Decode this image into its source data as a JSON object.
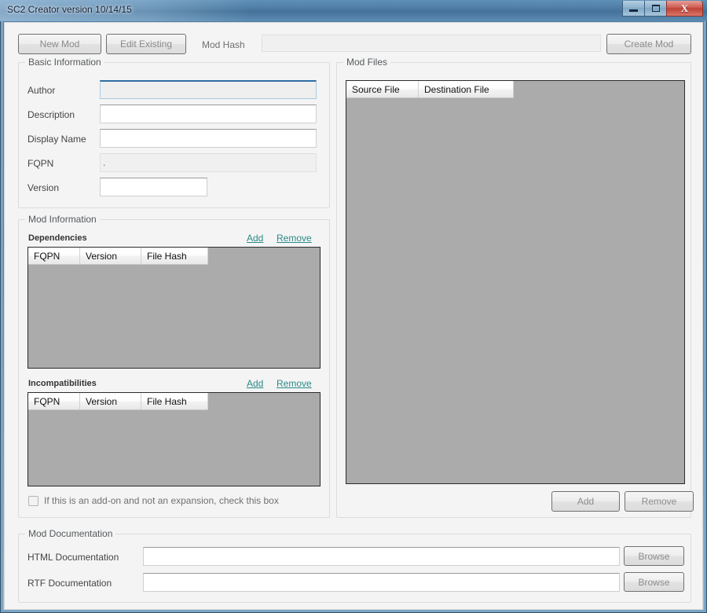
{
  "window": {
    "title": "SC2 Creator version 10/14/15",
    "controls": {
      "minimize": "minimize-button",
      "maximize": "maximize-button",
      "close": "X"
    }
  },
  "toolbar": {
    "new_mod": "New Mod",
    "edit_existing": "Edit Existing",
    "mod_hash_label": "Mod Hash",
    "mod_hash_value": "",
    "create_mod": "Create Mod"
  },
  "basic_information": {
    "title": "Basic Information",
    "fields": [
      {
        "label": "Author",
        "value": ""
      },
      {
        "label": "Description",
        "value": ""
      },
      {
        "label": "Display Name",
        "value": ""
      },
      {
        "label": "FQPN",
        "value": "."
      },
      {
        "label": "Version",
        "value": ""
      }
    ]
  },
  "mod_information": {
    "title": "Mod Information",
    "dependencies": {
      "label": "Dependencies",
      "add": "Add",
      "remove": "Remove",
      "columns": [
        "FQPN",
        "Version",
        "File Hash"
      ],
      "rows": []
    },
    "incompatibilities": {
      "label": "Incompatibilities",
      "add": "Add",
      "remove": "Remove",
      "columns": [
        "FQPN",
        "Version",
        "File Hash"
      ],
      "rows": []
    },
    "addon_checkbox": {
      "label": "If this is an add-on and not an expansion, check this box",
      "checked": false
    }
  },
  "mod_files": {
    "title": "Mod Files",
    "columns": [
      "Source File",
      "Destination File"
    ],
    "rows": [],
    "add": "Add",
    "remove": "Remove"
  },
  "mod_documentation": {
    "title": "Mod Documentation",
    "html_label": "HTML Documentation",
    "html_value": "",
    "html_browse": "Browse",
    "rtf_label": "RTF Documentation",
    "rtf_value": "",
    "rtf_browse": "Browse"
  },
  "colors": {
    "titlebar": "#4a789f",
    "link": "#2a8a8a",
    "list_body": "#ababab",
    "close_button": "#bf4236",
    "focus_border": "#2e6da4"
  }
}
